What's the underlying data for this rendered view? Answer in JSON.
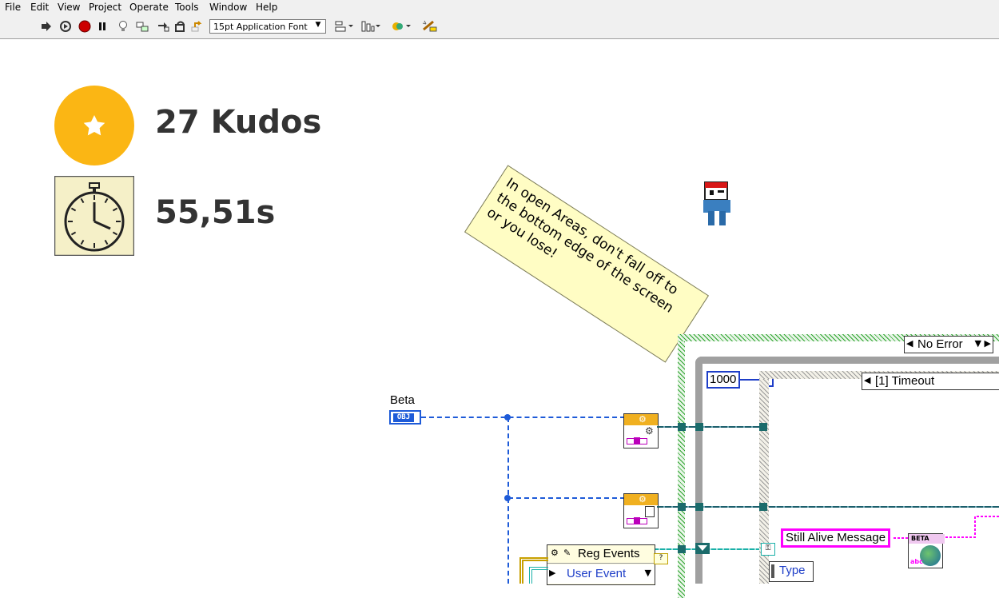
{
  "menu": [
    "File",
    "Edit",
    "View",
    "Project",
    "Operate",
    "Tools",
    "Window",
    "Help"
  ],
  "toolbar": {
    "font_select": "15pt Application Font",
    "icons": [
      "run-arrow-icon",
      "run-continuous-icon",
      "abort-icon",
      "pause-icon",
      "highlight-execution-icon",
      "retain-wire-values-icon",
      "step-into-icon",
      "step-over-icon",
      "step-out-icon",
      "align-objects-icon",
      "distribute-objects-icon",
      "reorder-icon",
      "cleanup-diagram-icon"
    ]
  },
  "stats": {
    "kudos": "27 Kudos",
    "time": "55,51s"
  },
  "colors": {
    "kudos_circle": "#fbb614",
    "stopwatch_bg": "#f5f0c8",
    "wire_blue": "#1e5bd8",
    "wire_teal": "#1b5e6b",
    "string_pink": "#ff00ff"
  },
  "note": "In open Areas, don't fall off to the bottom edge of the screen or you lose!",
  "diagram": {
    "beta_label": "Beta",
    "obj_tag": "OBJ",
    "case_selector": "No Error",
    "timeout_value": "1000",
    "event_case": "[1] Timeout",
    "string_const": "Still Alive Message",
    "reg_events": "Reg Events",
    "user_event": "User Event",
    "type_label": "Type",
    "beta_icon": "BETA"
  }
}
